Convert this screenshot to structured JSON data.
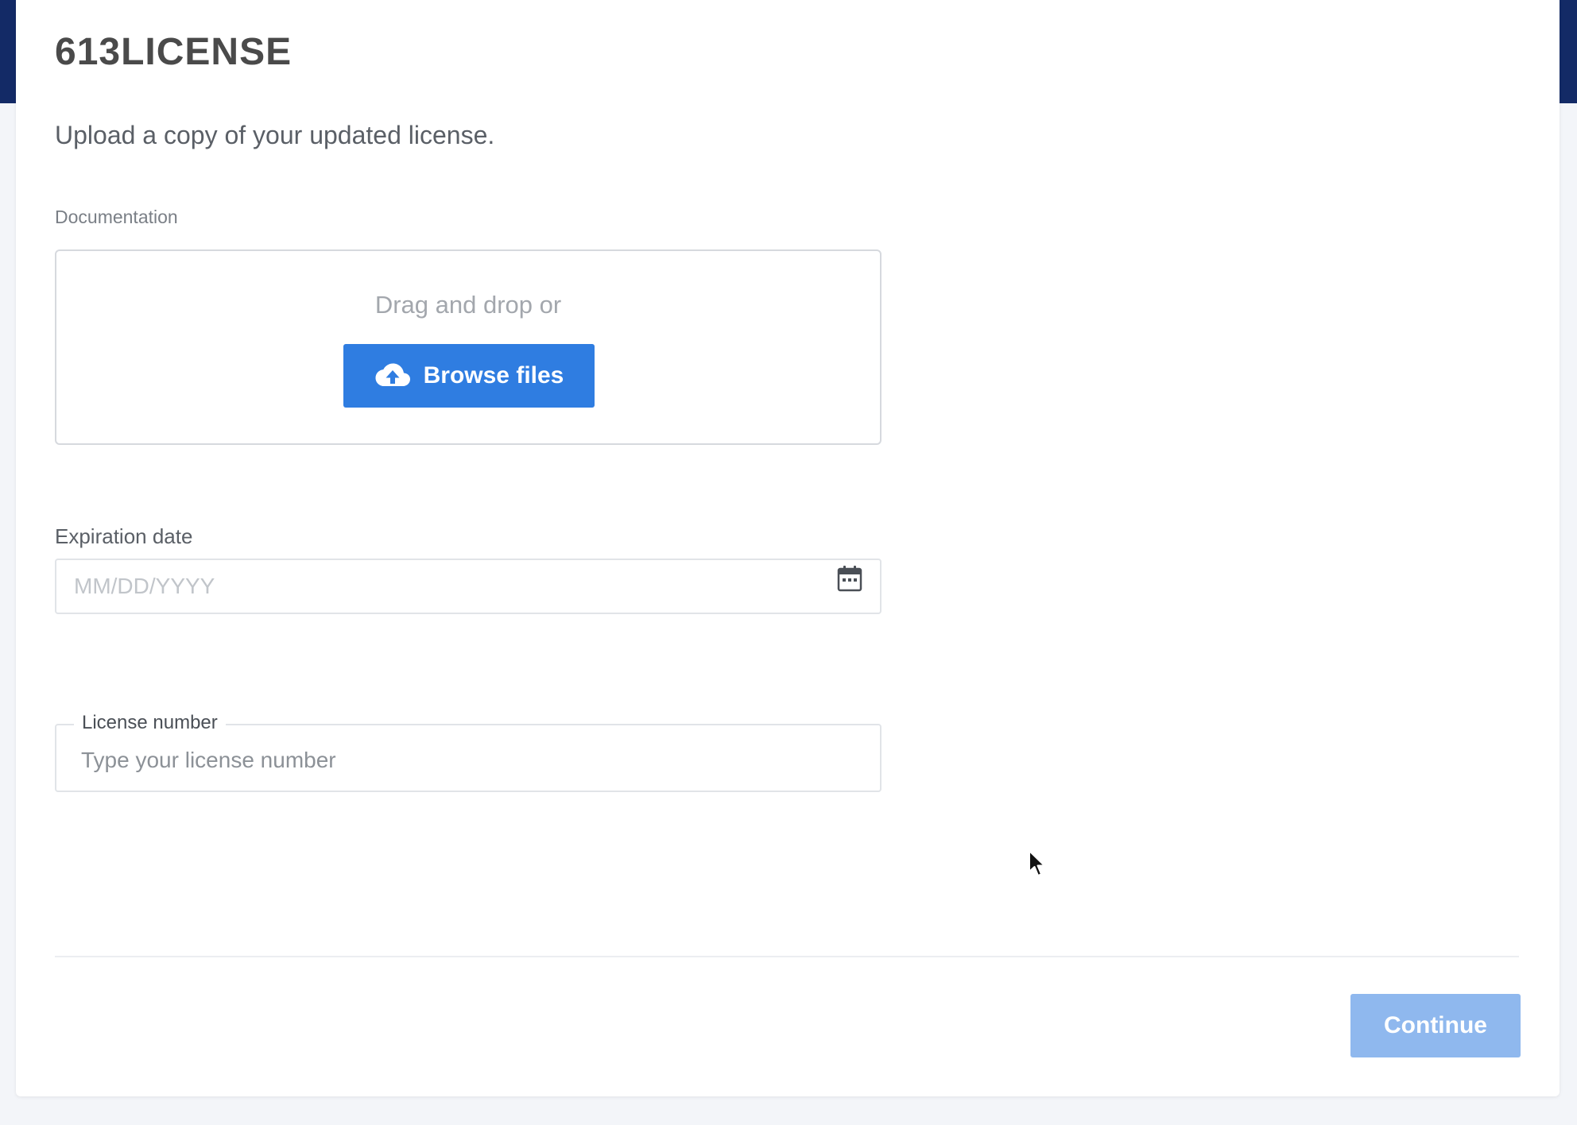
{
  "header": {
    "title": "613LICENSE",
    "subtitle": "Upload a copy of your updated license."
  },
  "documentation": {
    "label": "Documentation",
    "drop_text": "Drag and drop or",
    "browse_label": "Browse files",
    "icon": "cloud-upload-icon"
  },
  "expiration": {
    "label": "Expiration date",
    "placeholder": "MM/DD/YYYY",
    "value": "",
    "icon": "calendar-icon"
  },
  "license": {
    "label": "License number",
    "placeholder": "Type your license number",
    "value": ""
  },
  "footer": {
    "continue_label": "Continue",
    "continue_enabled": false
  },
  "colors": {
    "primary": "#2f7de1",
    "primary_disabled": "#8fb8ee",
    "nav_band": "#132a66",
    "background": "#f3f5f9"
  }
}
